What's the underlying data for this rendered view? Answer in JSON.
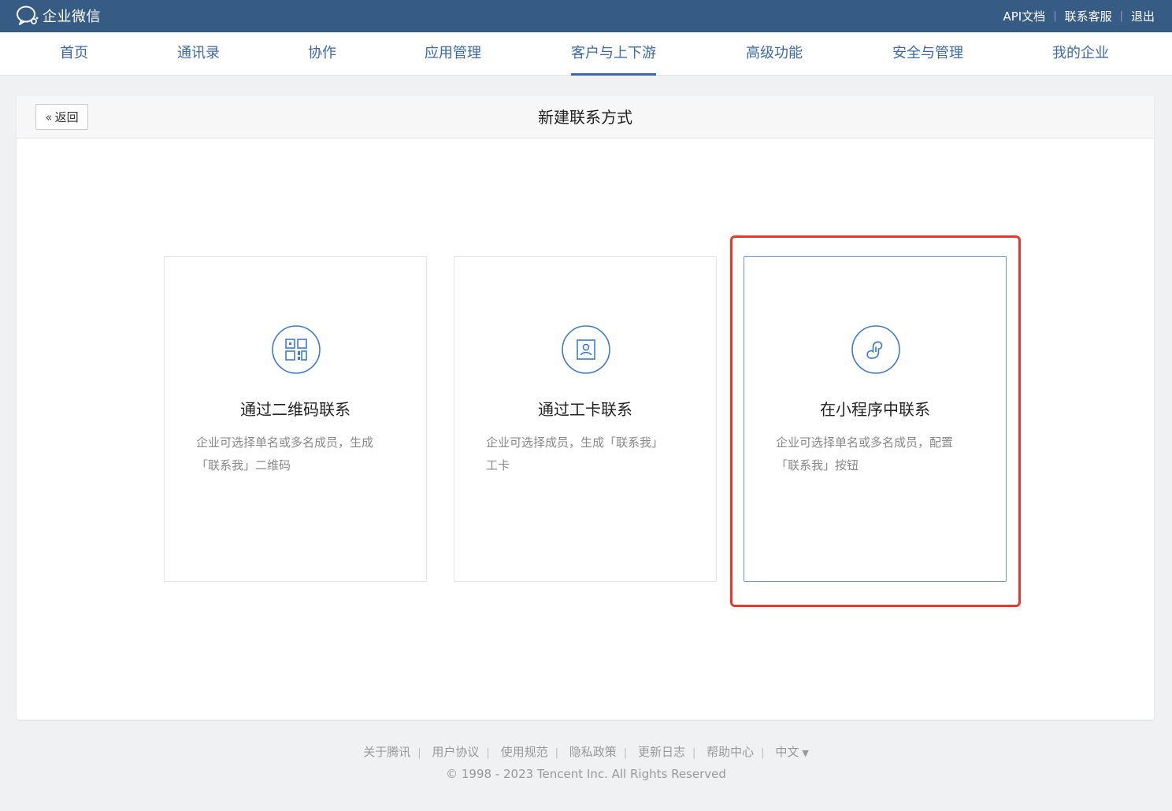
{
  "brand": {
    "name": "企业微信",
    "logo_icon": "wecom-logo-icon"
  },
  "top_links": [
    "API文档",
    "联系客服",
    "退出"
  ],
  "nav": {
    "items": [
      "首页",
      "通讯录",
      "协作",
      "应用管理",
      "客户与上下游",
      "高级功能",
      "安全与管理",
      "我的企业"
    ],
    "active": "客户与上下游"
  },
  "panel": {
    "back_label": "返回",
    "title": "新建联系方式"
  },
  "cards": [
    {
      "title": "通过二维码联系",
      "desc_line1": "企业可选择单名或多名成员，生成",
      "desc_line2": "「联系我」二维码",
      "icon": "qrcode-icon"
    },
    {
      "title": "通过工卡联系",
      "desc_line1": "企业可选择成员，生成「联系我」",
      "desc_line2": "工卡",
      "icon": "badge-card-icon"
    },
    {
      "title": "在小程序中联系",
      "desc_line1": "企业可选择单名或多名成员，配置",
      "desc_line2": "「联系我」按钮",
      "icon": "mini-program-icon"
    }
  ],
  "selected_card": 2,
  "footer": {
    "links": [
      "关于腾讯",
      "用户协议",
      "使用规范",
      "隐私政策",
      "更新日志",
      "帮助中心"
    ],
    "language": "中文",
    "copyright": "© 1998 - 2023 Tencent Inc. All Rights Reserved"
  },
  "colors": {
    "topbar": "#365b85",
    "nav_text": "#3d69a7",
    "icon_blue": "#3d7bd1",
    "highlight_red": "#e8382c",
    "selected_border": "#6e95cc"
  }
}
